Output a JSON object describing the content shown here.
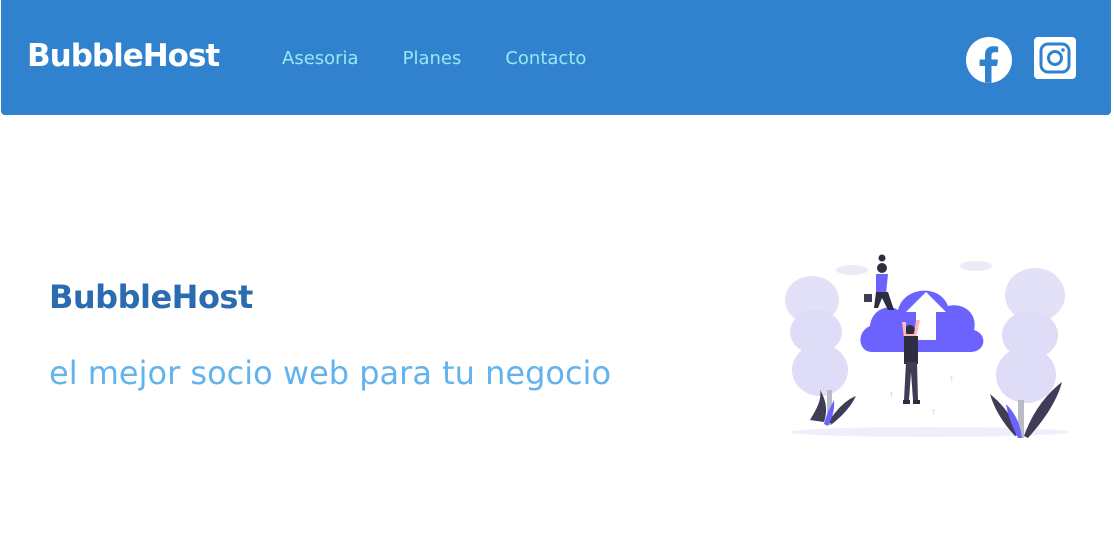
{
  "header": {
    "brand": "BubbleHost",
    "nav": [
      {
        "label": "Asesoria"
      },
      {
        "label": "Planes"
      },
      {
        "label": "Contacto"
      }
    ],
    "social": [
      {
        "icon": "facebook-icon"
      },
      {
        "icon": "instagram-icon"
      }
    ]
  },
  "hero": {
    "title": "BubbleHost",
    "subtitle": "el mejor socio web para tu negocio",
    "illustration": "cloud-upload-illustration"
  },
  "colors": {
    "navbar": "#3182ce",
    "nav_link": "#9ae6f4",
    "title": "#2b6cb0",
    "subtitle": "#63b3ed",
    "accent": "#6c63ff"
  }
}
